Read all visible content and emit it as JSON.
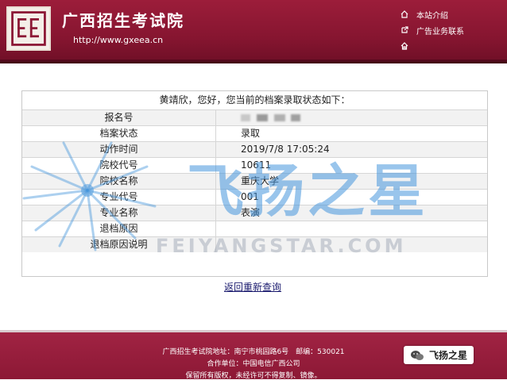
{
  "header": {
    "title": "广西招生考试院",
    "url": "http://www.gxeea.cn",
    "links": [
      {
        "label": "本站介绍",
        "icon": "home-icon"
      },
      {
        "label": "广告业务联系",
        "icon": "link-icon"
      },
      {
        "label": "",
        "icon": "house-icon"
      }
    ]
  },
  "result": {
    "greeting": "黄靖欣，您好，您当前的档案录取状态如下：",
    "rows": [
      {
        "label": "报名号",
        "value": ""
      },
      {
        "label": "档案状态",
        "value": "录取"
      },
      {
        "label": "动作时间",
        "value": "2019/7/8 17:05:24"
      },
      {
        "label": "院校代号",
        "value": "10611"
      },
      {
        "label": "院校名称",
        "value": "重庆大学"
      },
      {
        "label": "专业代号",
        "value": "001"
      },
      {
        "label": "专业名称",
        "value": "表演"
      },
      {
        "label": "退档原因",
        "value": ""
      },
      {
        "label": "退档原因说明",
        "value": ""
      }
    ]
  },
  "back_link": "返回重新查询",
  "watermark": {
    "cn": "飞扬之星",
    "en": "FEIYANGSTAR.COM"
  },
  "footer": {
    "address": "广西招生考试院地址：南宁市桃园路6号　邮编：530021",
    "partner": "合作单位：中国电信广西公司",
    "rights": "保留所有版权，未经许可不得复制、镜像。"
  },
  "badge": {
    "label": "飞扬之星",
    "icon": "wechat-icon"
  },
  "colors": {
    "brand": "#8c1835",
    "link": "#1a1a6e"
  }
}
